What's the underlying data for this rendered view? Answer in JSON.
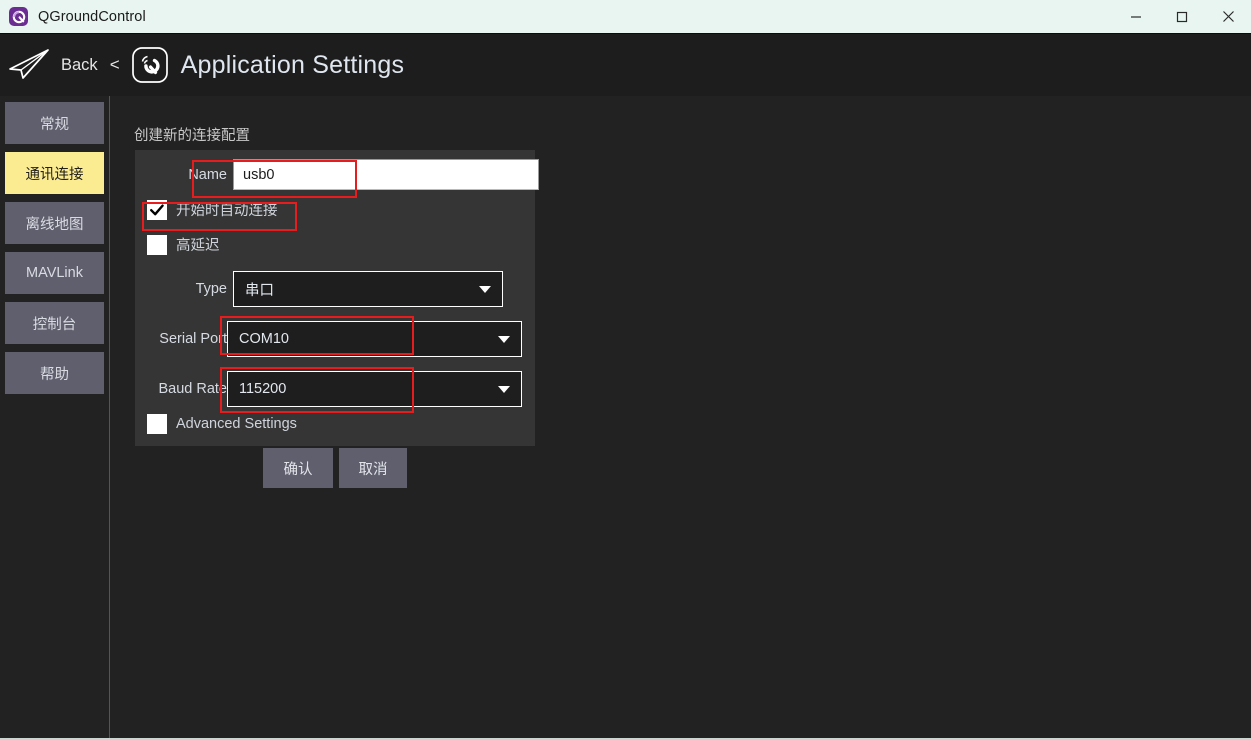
{
  "window": {
    "title": "QGroundControl",
    "icon": "qgroundcontrol-app-icon",
    "controls": {
      "minimize": "minimize-icon",
      "maximize": "maximize-icon",
      "close": "close-icon"
    }
  },
  "header": {
    "logo": "paper-plane-icon",
    "back_label": "Back",
    "back_caret": "<",
    "badge_icon": "qgc-q-icon",
    "title": "Application Settings"
  },
  "sidebar": {
    "items": [
      {
        "label": "常规",
        "selected": false
      },
      {
        "label": "通讯连接",
        "selected": true
      },
      {
        "label": "离线地图",
        "selected": false
      },
      {
        "label": "MAVLink",
        "selected": false
      },
      {
        "label": "控制台",
        "selected": false
      },
      {
        "label": "帮助",
        "selected": false
      }
    ]
  },
  "form": {
    "section_title": "创建新的连接配置",
    "name": {
      "label": "Name",
      "value": "usb0",
      "placeholder": ""
    },
    "auto_connect": {
      "label": "开始时自动连接",
      "checked": true
    },
    "high_latency": {
      "label": "高延迟",
      "checked": false
    },
    "type": {
      "label": "Type",
      "value": "串口",
      "options": [
        "串口"
      ]
    },
    "serial_port": {
      "label": "Serial Port",
      "value": "COM10",
      "options": [
        "COM10"
      ]
    },
    "baud_rate": {
      "label": "Baud Rate",
      "value": "115200",
      "options": [
        "115200"
      ]
    },
    "advanced_settings": {
      "label": "Advanced Settings",
      "checked": false
    },
    "buttons": {
      "ok": "确认",
      "cancel": "取消"
    }
  },
  "annotations": {
    "color": "#e71d1d",
    "targets": [
      "name-input",
      "auto-connect-checkbox",
      "serial-port-combo",
      "baud-rate-combo"
    ]
  }
}
